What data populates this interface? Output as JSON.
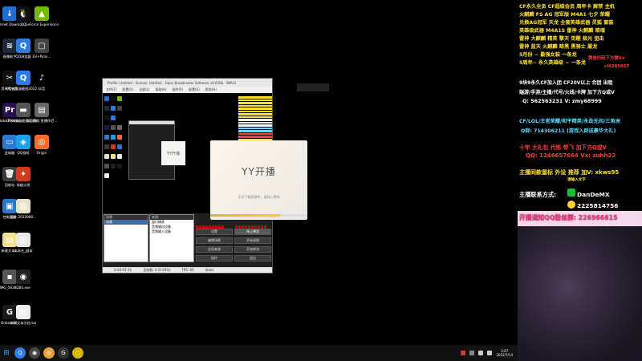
{
  "desktop_icons": [
    {
      "label": "Internet Downlo...",
      "color": "#1d6fd6",
      "glyph": "↓"
    },
    {
      "label": "QQ",
      "color": "#111111",
      "glyph": "🐧"
    },
    {
      "label": "GeForce Experience",
      "color": "#76b900",
      "glyph": "▲"
    },
    {
      "label": "直播助手",
      "color": "#1e2a3a",
      "glyph": "≋"
    },
    {
      "label": "QQ浏览器",
      "color": "#2d7be5",
      "glyph": "Q"
    },
    {
      "label": "EV+Palin...",
      "color": "#444444",
      "glyph": "▢"
    },
    {
      "label": "剪映专业版",
      "color": "#111111",
      "glyph": "✂"
    },
    {
      "label": "QQ浏览器截图2022...",
      "color": "#2d7be5",
      "glyph": "Q"
    },
    {
      "label": "抖音",
      "color": "#000000",
      "glyph": "♪"
    },
    {
      "label": "Adobe Premie...",
      "color": "#2a0f4f",
      "glyph": "Pr"
    },
    {
      "label": "QQ浏览器截图2022...",
      "color": "#555555",
      "glyph": "▬"
    },
    {
      "label": "双击播放 直播伴侣...",
      "color": "#666666",
      "glyph": "▤"
    },
    {
      "label": "此电脑",
      "color": "#2b79d0",
      "glyph": "▭"
    },
    {
      "label": "QQ游戏",
      "color": "#1aa1e6",
      "glyph": "◈"
    },
    {
      "label": "Origin",
      "color": "#f56c2d",
      "glyph": "◎"
    },
    {
      "label": "回收站",
      "color": "#3b3b3b",
      "glyph": "🗑"
    },
    {
      "label": "穿越火线",
      "color": "#d23a1c",
      "glyph": "✦"
    },
    {
      "label": "控制面板",
      "color": "#2a79c9",
      "glyph": "▣"
    },
    {
      "label": "图片 2022080...",
      "color": "#e8e0c8",
      "glyph": "▨"
    },
    {
      "label": "新建文本...",
      "color": "#f1e28b",
      "glyph": "▤"
    },
    {
      "label": "未命名_副本",
      "color": "#e8e8e8",
      "glyph": "▥"
    },
    {
      "label": "IMG_5638...",
      "color": "#555555",
      "glyph": "▪"
    },
    {
      "label": "OBS.exe",
      "color": "#222222",
      "glyph": "◉"
    },
    {
      "label": "Onboard...",
      "color": "#1a1a1a",
      "glyph": "G"
    },
    {
      "label": "新建文本文档.txt",
      "color": "#eeeeee",
      "glyph": "▤"
    }
  ],
  "obs": {
    "title": "Profile: Untitled - Scenes: Untitled - Open Broadcaster Software v0.659b - BMG4",
    "menu": [
      "文件(F)",
      "配置(S)",
      "全屏(L)",
      "帮助(H)",
      "插件(P)",
      "配置(E)",
      "帮助(H)"
    ],
    "scenes_header": "场景:",
    "scenes": [
      "场景"
    ],
    "sources_header": "来源:",
    "sources": [
      "窗口捕获",
      "音频输出设备",
      "音频输入设备"
    ],
    "buttons": {
      "settings": "设置",
      "stop_preview": "停止预览",
      "edit_scene": "编辑场景",
      "start_rec": "开始录制",
      "global_sources": "全局来源",
      "preview": "开始串流",
      "plugins": "插件",
      "exit": "退出"
    },
    "status": [
      "0:00:03 (0)",
      "丢帧数: 0 (0.00%)",
      "FPS: 60",
      "0kb/s"
    ]
  },
  "yy_dialog": {
    "title": "YY开播",
    "subtitle": "正在下载资源中，请耐心等待",
    "progress": 0.72
  },
  "taskbar": {
    "apps": [
      {
        "color": "#2d7be5",
        "glyph": "Q"
      },
      {
        "color": "#444444",
        "glyph": "◉"
      },
      {
        "color": "#e5a23a",
        "glyph": "◎"
      },
      {
        "color": "#333333",
        "glyph": "G"
      },
      {
        "color": "#d9b400",
        "glyph": "◌"
      }
    ],
    "time": "2:47",
    "date": "2022/7/14"
  },
  "overlay": {
    "lines": [
      {
        "text": "CF永久全员 CF超级会员 周年卡 解禁 主机",
        "color": "#ffe22b",
        "bg": "#000000",
        "size": 6.2
      },
      {
        "text": "火麒麟 FS AG 冠军版 M4A1 七夕 荣耀",
        "color": "#ffe22b",
        "bg": "#000000",
        "size": 6.2
      },
      {
        "text": "兑换AG冠军 天龙 全套英雄武器 灵狐 套装",
        "color": "#ffe22b",
        "bg": "#000000",
        "size": 6.2
      },
      {
        "text": "英雄级武器 M4A1S 雷神 火麒麟 暗魂",
        "color": "#ffe22b",
        "bg": "#000000",
        "size": 6.2
      },
      {
        "text": "雷神 大麒麟 精英 擎天 觉醒 极光 狙击",
        "color": "#ffe22b",
        "bg": "#000000",
        "size": 6.2
      },
      {
        "text": "雷神 蓝天 火麒麟 暗黑 黑骑士 屠龙",
        "color": "#ffe22b",
        "bg": "#000000",
        "size": 6.2
      },
      {
        "text": "5月份 ~ 最强女装 一条龙",
        "color": "#ffe22b",
        "bg": "#000000",
        "size": 6.2
      },
      {
        "text": "5周年~ 永久英雄级 ~ 一条龙",
        "color": "#ffe22b",
        "bg": "#000000",
        "size": 6.2
      },
      {
        "text": "9块9永久CF加入团 CF20V以上 合团 出租",
        "color": "#ffffff",
        "bg": "#000000",
        "size": 6.0
      },
      {
        "text": "端游/手游/主播/代号/火线/卡牌 加下方Q或V",
        "color": "#ffffff",
        "bg": "#000000",
        "size": 6.0
      },
      {
        "text": "Q: 562563231  V: zmy68999",
        "color": "#ffffff",
        "bg": "#000000",
        "size": 6.4
      },
      {
        "text": "CF/LOL/王者荣耀/和平精英/永劫无间/三角洲",
        "color": "#5fd8ff",
        "bg": "#000000",
        "size": 6.2
      },
      {
        "text": "Q群: 714306211 (游戏入群送豪华大礼)",
        "color": "#5fd8ff",
        "bg": "#000000",
        "size": 6.2
      },
      {
        "text": "十年 大礼包 代练 带飞 加下方Q或V",
        "color": "#ff3b3b",
        "bg": "#000000",
        "size": 6.8
      },
      {
        "text": "QQ: 1246657664  Vx: zuhh22",
        "color": "#ff3b3b",
        "bg": "#000000",
        "size": 7.0
      },
      {
        "text": "主播同款鼠标 外设 推荐 加V: xkws95",
        "color": "#ffe22b",
        "bg": "#000000",
        "size": 7.0
      },
      {
        "text": "主播联系方式:",
        "color": "#ffffff",
        "bg": "#000000",
        "size": 7.2
      },
      {
        "text": "DanDeMX",
        "color": "#ffffff",
        "bg": "#000000",
        "size": 7.4
      },
      {
        "text": "2225814756",
        "color": "#ffffff",
        "bg": "#000000",
        "size": 7.4
      },
      {
        "text": "开播通知QQ粉丝群: 226966615",
        "color": "#ffffff",
        "bg": "#f3d8ec",
        "size": 7.8
      }
    ],
    "promo": {
      "text": "微信扫码下方微Vx",
      "sub": "cl6285667",
      "color": "#ff3b3b"
    },
    "small_note": "请输入文字"
  }
}
